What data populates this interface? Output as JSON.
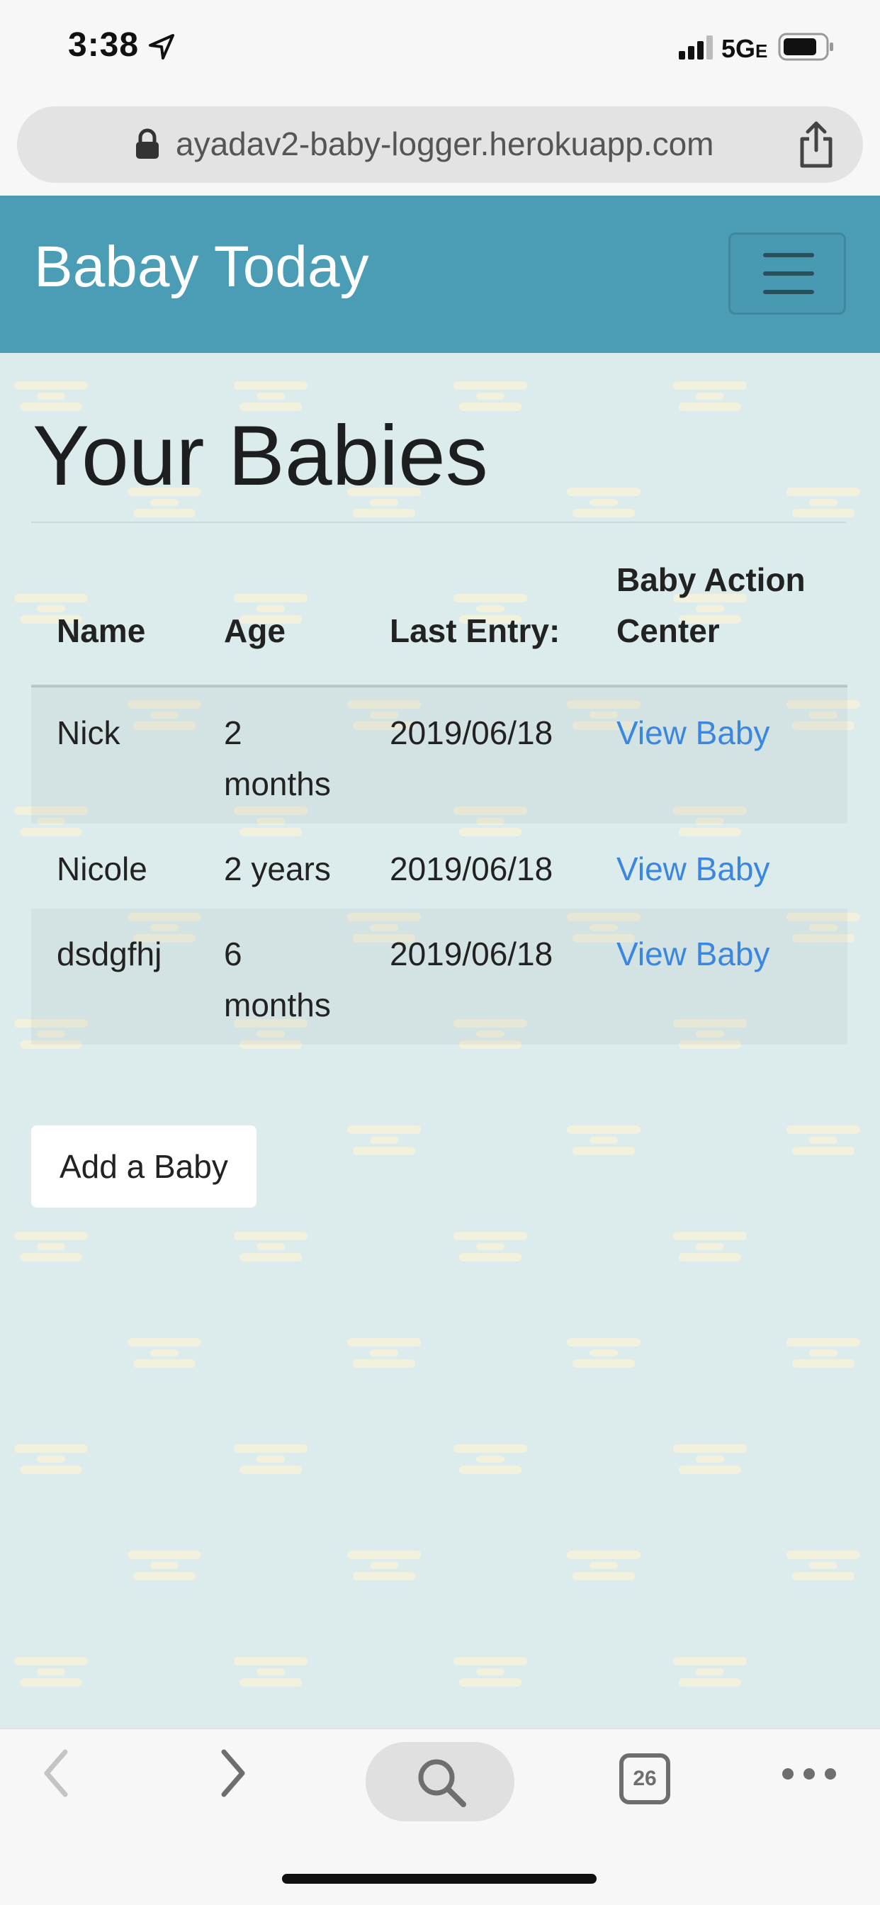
{
  "status_bar": {
    "time": "3:38",
    "network": "5G",
    "network_suffix": "E"
  },
  "browser": {
    "url": "ayadav2-baby-logger.herokuapp.com",
    "tab_count": "26"
  },
  "navbar": {
    "brand": "Babay Today"
  },
  "page": {
    "title": "Your Babies",
    "table": {
      "headers": {
        "name": "Name",
        "age": "Age",
        "last_entry": "Last Entry:",
        "action": "Baby Action Center"
      },
      "rows": [
        {
          "name": "Nick",
          "age": "2 months",
          "last_entry": "2019/06/18",
          "action_label": "View Baby"
        },
        {
          "name": "Nicole",
          "age": "2 years",
          "last_entry": "2019/06/18",
          "action_label": "View Baby"
        },
        {
          "name": "dsdgfhj",
          "age": "6 months",
          "last_entry": "2019/06/18",
          "action_label": "View Baby"
        }
      ]
    },
    "add_button_label": "Add a Baby"
  },
  "colors": {
    "navbar_bg": "#4a9db5",
    "content_bg": "#dcecec",
    "link": "#3b86e0"
  },
  "icons": {
    "location": "location-arrow-icon",
    "signal": "signal-icon",
    "battery": "battery-icon",
    "lock": "lock-icon",
    "share": "share-icon",
    "menu": "hamburger-menu-icon",
    "back": "chevron-left-icon",
    "forward": "chevron-right-icon",
    "search": "search-icon",
    "tabs": "tabs-icon",
    "more": "more-icon"
  }
}
